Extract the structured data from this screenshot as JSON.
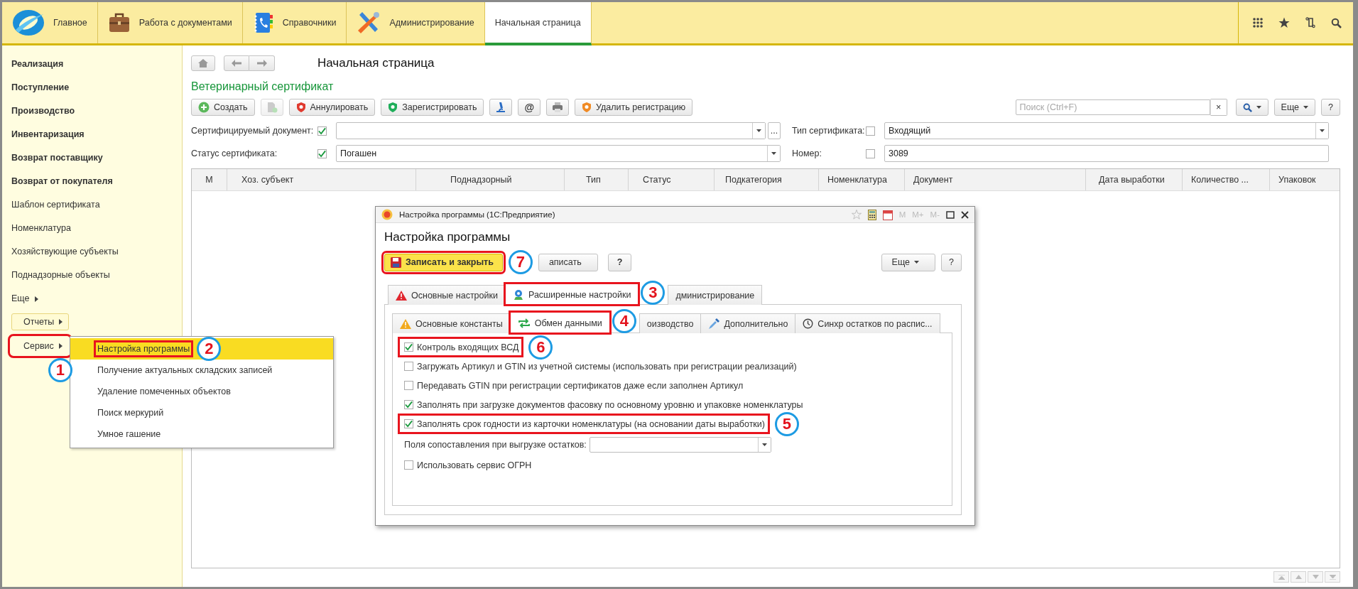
{
  "top_nav": {
    "tabs": [
      {
        "label": "Главное",
        "selected": false
      },
      {
        "label": "Работа с документами",
        "selected": false
      },
      {
        "label": "Справочники",
        "selected": false
      },
      {
        "label": "Администрирование",
        "selected": false
      },
      {
        "label": "Начальная страница",
        "selected": true
      }
    ]
  },
  "sidebar": {
    "items": [
      {
        "label": "Реализация",
        "bold": true
      },
      {
        "label": "Поступление",
        "bold": true
      },
      {
        "label": "Производство",
        "bold": true
      },
      {
        "label": "Инвентаризация",
        "bold": true
      },
      {
        "label": "Возврат поставщику",
        "bold": true
      },
      {
        "label": "Возврат от покупателя",
        "bold": true
      },
      {
        "label": "Шаблон сертификата",
        "bold": false
      },
      {
        "label": "Номенклатура",
        "bold": false
      },
      {
        "label": "Хозяйствующие субъекты",
        "bold": false
      },
      {
        "label": "Поднадзорные объекты",
        "bold": false
      }
    ],
    "more": "Еще",
    "buttons": [
      {
        "label": "Отчеты",
        "highlighted": false
      },
      {
        "label": "Сервис",
        "highlighted": true,
        "callout": "1"
      }
    ]
  },
  "service_menu": {
    "items": [
      {
        "label": "Настройка программы",
        "selected": true,
        "highlighted": true,
        "callout": "2"
      },
      {
        "label": "Получение актуальных складских записей",
        "selected": false,
        "highlighted": false
      },
      {
        "label": "Удаление помеченных объектов",
        "selected": false,
        "highlighted": false
      },
      {
        "label": "Поиск меркурий",
        "selected": false,
        "highlighted": false
      },
      {
        "label": "Умное гашение",
        "selected": false,
        "highlighted": false
      }
    ]
  },
  "page": {
    "title": "Начальная страница",
    "form_title": "Ветеринарный сертификат",
    "toolbar": [
      {
        "kind": "button",
        "label": "Создать",
        "disabled": false
      },
      {
        "kind": "icon",
        "disabled": true
      },
      {
        "kind": "button",
        "label": "Аннулировать",
        "disabled": false
      },
      {
        "kind": "button",
        "label": "Зарегистрировать",
        "disabled": false
      },
      {
        "kind": "icon",
        "disabled": false
      },
      {
        "kind": "button",
        "label": "@",
        "disabled": false
      },
      {
        "kind": "icon",
        "disabled": false
      },
      {
        "kind": "button",
        "label": "Удалить регистрацию",
        "disabled": false
      }
    ],
    "search": {
      "placeholder": "Поиск (Ctrl+F)",
      "clear": "×"
    },
    "more": "Еще",
    "help": "?",
    "filters": [
      {
        "label": "Сертифицируемый документ:",
        "checked": true,
        "dropdown": true,
        "choice_button": "..."
      },
      {
        "label": "Тип сертификата:",
        "checked": false,
        "value": "Входящий",
        "dropdown": true
      },
      {
        "label": "Статус сертификата:",
        "checked": true,
        "value": "Погашен",
        "dropdown": true
      },
      {
        "label": "Номер:",
        "checked": false,
        "value": "3089",
        "dropdown": false
      }
    ],
    "table": {
      "columns": [
        "М",
        "Хоз. субъект",
        "Поднадзорный",
        "Тип",
        "Статус",
        "Подкатегория",
        "Номенклатура",
        "Документ",
        "Дата выработки",
        "Количество ...",
        "Упаковок"
      ]
    }
  },
  "dialog": {
    "title": "Настройка программы (1С:Предприятие)",
    "memory_buttons": [
      "M",
      "M+",
      "M-"
    ],
    "heading": "Настройка программы",
    "buttons": [
      {
        "kind": "primary",
        "label": "Записать и закрыть",
        "highlighted": true,
        "callout": "7"
      },
      {
        "kind": "plain",
        "label": "аписать",
        "highlighted": false
      },
      {
        "kind": "help",
        "label": "?",
        "highlighted": false
      }
    ],
    "more": "Еще",
    "help": "?",
    "tabs": [
      {
        "label": "Основные настройки",
        "selected": false,
        "highlighted": false
      },
      {
        "label": "Расширенные настройки",
        "selected": true,
        "highlighted": true,
        "callout": "3"
      },
      {
        "label": "дминистрирование",
        "selected": false,
        "highlighted": false
      }
    ],
    "subtabs": [
      {
        "label": "Основные константы",
        "selected": false,
        "highlighted": false
      },
      {
        "label": "Обмен данными",
        "selected": true,
        "highlighted": true,
        "callout": "4"
      },
      {
        "label": "оизводство",
        "selected": false,
        "highlighted": false
      },
      {
        "label": "Дополнительно",
        "selected": false,
        "highlighted": false
      },
      {
        "label": "Синхр остатков по распис...",
        "selected": false,
        "highlighted": false
      }
    ],
    "options": [
      {
        "kind": "checkbox",
        "label": "Контроль входящих ВСД",
        "checked": true,
        "highlighted": true,
        "callout": "6"
      },
      {
        "kind": "checkbox",
        "label": "Загружать Артикул и GTIN из учетной системы (использовать при регистрации реализаций)",
        "checked": false,
        "highlighted": false
      },
      {
        "kind": "checkbox",
        "label": "Передавать GTIN при регистрации сертификатов даже если заполнен Артикул",
        "checked": false,
        "highlighted": false
      },
      {
        "kind": "checkbox",
        "label": "Заполнять при загрузке документов фасовку по основному уровню и упаковке номенклатуры",
        "checked": true,
        "highlighted": false
      },
      {
        "kind": "checkbox",
        "label": "Заполнять срок годности из карточки номенклатуры (на основании даты выработки)",
        "checked": true,
        "highlighted": true,
        "callout": "5"
      },
      {
        "kind": "select",
        "label": "Поля сопоставления при выгрузке остатков:"
      },
      {
        "kind": "checkbox",
        "label": "Использовать сервис ОГРН",
        "checked": false,
        "highlighted": false
      }
    ]
  }
}
